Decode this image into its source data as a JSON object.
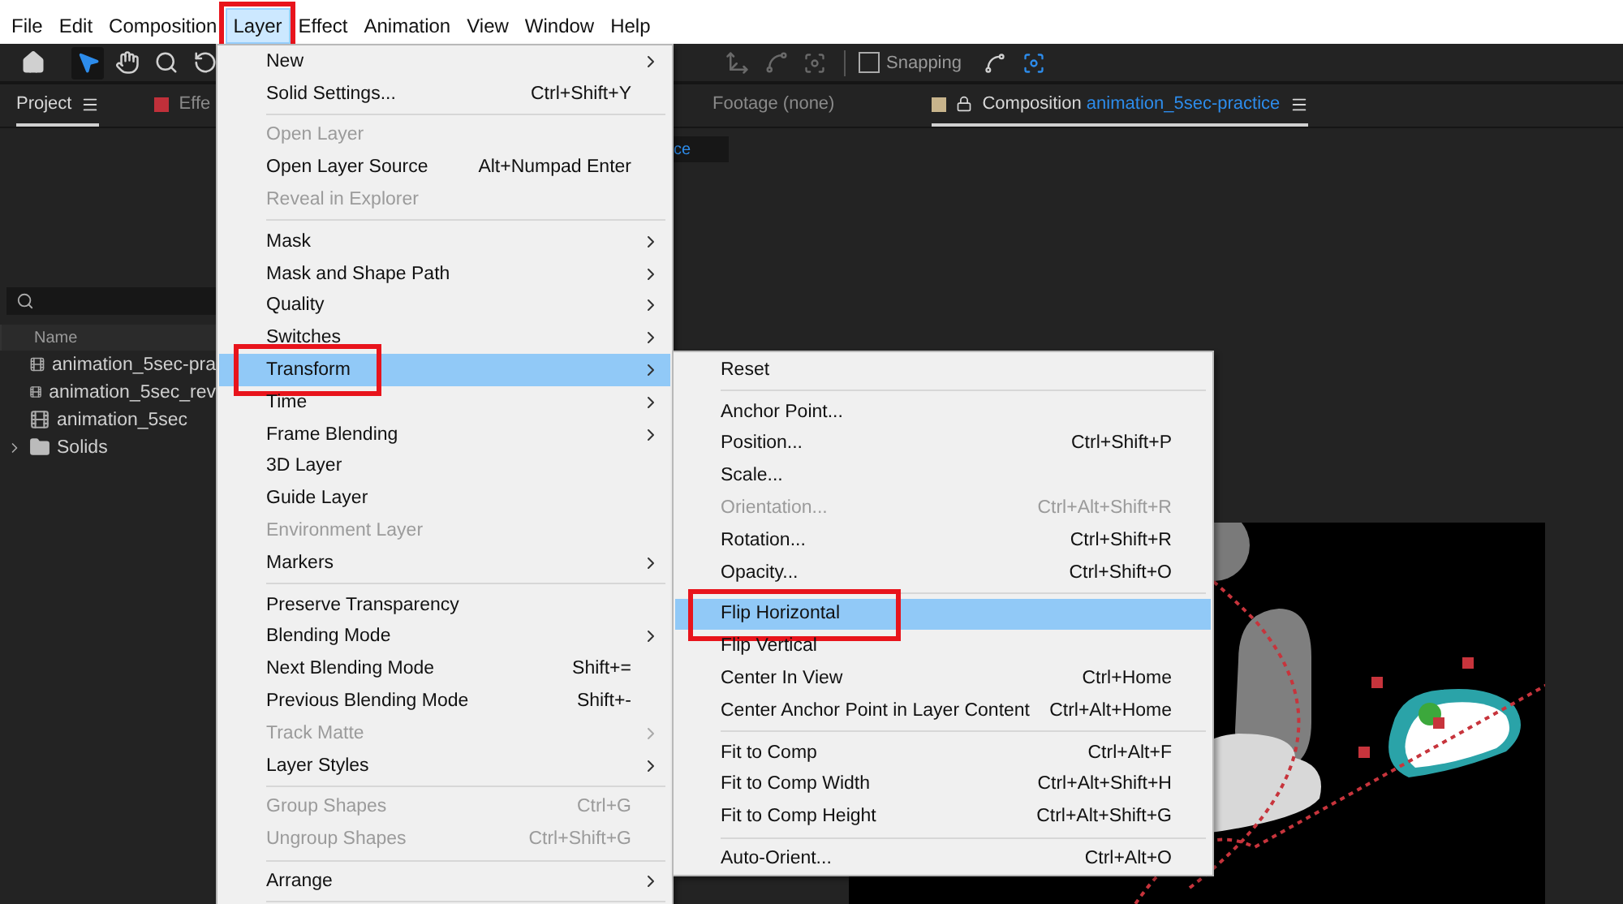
{
  "menu_bar": [
    {
      "label": "File",
      "selected": false,
      "outlined": false
    },
    {
      "label": "Edit",
      "selected": false,
      "outlined": false
    },
    {
      "label": "Composition",
      "selected": false,
      "outlined": false
    },
    {
      "label": "Layer",
      "selected": true,
      "outlined": true
    },
    {
      "label": "Effect",
      "selected": false,
      "outlined": false
    },
    {
      "label": "Animation",
      "selected": false,
      "outlined": false
    },
    {
      "label": "View",
      "selected": false,
      "outlined": false
    },
    {
      "label": "Window",
      "selected": false,
      "outlined": false
    },
    {
      "label": "Help",
      "selected": false,
      "outlined": false
    }
  ],
  "toolbar": {
    "snapping": {
      "label": "Snapping",
      "checked": false
    }
  },
  "project_panel": {
    "tabs": [
      {
        "label": "Project",
        "selected": true
      },
      {
        "label": "Effe",
        "selected": false
      }
    ],
    "column": "Name",
    "items": [
      {
        "kind": "composition",
        "label": "animation_5sec-pra"
      },
      {
        "kind": "composition",
        "label": "animation_5sec_rev"
      },
      {
        "kind": "composition",
        "label": "animation_5sec"
      },
      {
        "kind": "folder",
        "label": "Solids"
      }
    ]
  },
  "viewer": {
    "tabs": [
      {
        "label": "Footage (none)",
        "selected": false
      },
      {
        "label": "Composition",
        "name": "animation_5sec-practice",
        "selected": true
      }
    ],
    "field_value": "ce"
  },
  "layer_menu": {
    "items": [
      {
        "kind": "item",
        "label": "New",
        "submenu": true,
        "disabled": false,
        "selected": false,
        "outlined": false
      },
      {
        "kind": "item",
        "label": "Solid Settings...",
        "shortcut": "Ctrl+Shift+Y",
        "submenu": false,
        "disabled": false,
        "selected": false,
        "outlined": false
      },
      {
        "kind": "separator"
      },
      {
        "kind": "item",
        "label": "Open Layer",
        "submenu": false,
        "disabled": true,
        "selected": false,
        "outlined": false
      },
      {
        "kind": "item",
        "label": "Open Layer Source",
        "shortcut": "Alt+Numpad Enter",
        "submenu": false,
        "disabled": false,
        "selected": false,
        "outlined": false
      },
      {
        "kind": "item",
        "label": "Reveal in Explorer",
        "submenu": false,
        "disabled": true,
        "selected": false,
        "outlined": false
      },
      {
        "kind": "separator"
      },
      {
        "kind": "item",
        "label": "Mask",
        "submenu": true,
        "disabled": false,
        "selected": false,
        "outlined": false
      },
      {
        "kind": "item",
        "label": "Mask and Shape Path",
        "submenu": true,
        "disabled": false,
        "selected": false,
        "outlined": false
      },
      {
        "kind": "item",
        "label": "Quality",
        "submenu": true,
        "disabled": false,
        "selected": false,
        "outlined": false
      },
      {
        "kind": "item",
        "label": "Switches",
        "submenu": true,
        "disabled": false,
        "selected": false,
        "outlined": false
      },
      {
        "kind": "item",
        "label": "Transform",
        "submenu": true,
        "disabled": false,
        "selected": true,
        "outlined": true
      },
      {
        "kind": "item",
        "label": "Time",
        "submenu": true,
        "disabled": false,
        "selected": false,
        "outlined": false
      },
      {
        "kind": "item",
        "label": "Frame Blending",
        "submenu": true,
        "disabled": false,
        "selected": false,
        "outlined": false
      },
      {
        "kind": "item",
        "label": "3D Layer",
        "submenu": false,
        "disabled": false,
        "selected": false,
        "outlined": false
      },
      {
        "kind": "item",
        "label": "Guide Layer",
        "submenu": false,
        "disabled": false,
        "selected": false,
        "outlined": false
      },
      {
        "kind": "item",
        "label": "Environment Layer",
        "submenu": false,
        "disabled": true,
        "selected": false,
        "outlined": false
      },
      {
        "kind": "item",
        "label": "Markers",
        "submenu": true,
        "disabled": false,
        "selected": false,
        "outlined": false
      },
      {
        "kind": "separator"
      },
      {
        "kind": "item",
        "label": "Preserve Transparency",
        "submenu": false,
        "disabled": false,
        "selected": false,
        "outlined": false
      },
      {
        "kind": "item",
        "label": "Blending Mode",
        "submenu": true,
        "disabled": false,
        "selected": false,
        "outlined": false
      },
      {
        "kind": "item",
        "label": "Next Blending Mode",
        "shortcut": "Shift+=",
        "submenu": false,
        "disabled": false,
        "selected": false,
        "outlined": false
      },
      {
        "kind": "item",
        "label": "Previous Blending Mode",
        "shortcut": "Shift+-",
        "submenu": false,
        "disabled": false,
        "selected": false,
        "outlined": false
      },
      {
        "kind": "item",
        "label": "Track Matte",
        "submenu": true,
        "disabled": true,
        "selected": false,
        "outlined": false
      },
      {
        "kind": "item",
        "label": "Layer Styles",
        "submenu": true,
        "disabled": false,
        "selected": false,
        "outlined": false
      },
      {
        "kind": "separator"
      },
      {
        "kind": "item",
        "label": "Group Shapes",
        "shortcut": "Ctrl+G",
        "submenu": false,
        "disabled": true,
        "selected": false,
        "outlined": false
      },
      {
        "kind": "item",
        "label": "Ungroup Shapes",
        "shortcut": "Ctrl+Shift+G",
        "submenu": false,
        "disabled": true,
        "selected": false,
        "outlined": false
      },
      {
        "kind": "separator"
      },
      {
        "kind": "item",
        "label": "Arrange",
        "submenu": true,
        "disabled": false,
        "selected": false,
        "outlined": false
      },
      {
        "kind": "separator"
      }
    ]
  },
  "transform_submenu": {
    "items": [
      {
        "kind": "item",
        "label": "Reset",
        "submenu": false,
        "disabled": false,
        "selected": false,
        "outlined": false
      },
      {
        "kind": "separator"
      },
      {
        "kind": "item",
        "label": "Anchor Point...",
        "submenu": false,
        "disabled": false,
        "selected": false,
        "outlined": false
      },
      {
        "kind": "item",
        "label": "Position...",
        "shortcut": "Ctrl+Shift+P",
        "submenu": false,
        "disabled": false,
        "selected": false,
        "outlined": false
      },
      {
        "kind": "item",
        "label": "Scale...",
        "submenu": false,
        "disabled": false,
        "selected": false,
        "outlined": false
      },
      {
        "kind": "item",
        "label": "Orientation...",
        "shortcut": "Ctrl+Alt+Shift+R",
        "submenu": false,
        "disabled": true,
        "selected": false,
        "outlined": false
      },
      {
        "kind": "item",
        "label": "Rotation...",
        "shortcut": "Ctrl+Shift+R",
        "submenu": false,
        "disabled": false,
        "selected": false,
        "outlined": false
      },
      {
        "kind": "item",
        "label": "Opacity...",
        "shortcut": "Ctrl+Shift+O",
        "submenu": false,
        "disabled": false,
        "selected": false,
        "outlined": false
      },
      {
        "kind": "separator"
      },
      {
        "kind": "item",
        "label": "Flip Horizontal",
        "submenu": false,
        "disabled": false,
        "selected": true,
        "outlined": true
      },
      {
        "kind": "item",
        "label": "Flip Vertical",
        "submenu": false,
        "disabled": false,
        "selected": false,
        "outlined": false
      },
      {
        "kind": "item",
        "label": "Center In View",
        "shortcut": "Ctrl+Home",
        "submenu": false,
        "disabled": false,
        "selected": false,
        "outlined": false
      },
      {
        "kind": "item",
        "label": "Center Anchor Point in Layer Content",
        "shortcut": "Ctrl+Alt+Home",
        "submenu": false,
        "disabled": false,
        "selected": false,
        "outlined": false
      },
      {
        "kind": "separator"
      },
      {
        "kind": "item",
        "label": "Fit to Comp",
        "shortcut": "Ctrl+Alt+F",
        "submenu": false,
        "disabled": false,
        "selected": false,
        "outlined": false
      },
      {
        "kind": "item",
        "label": "Fit to Comp Width",
        "shortcut": "Ctrl+Alt+Shift+H",
        "submenu": false,
        "disabled": false,
        "selected": false,
        "outlined": false
      },
      {
        "kind": "item",
        "label": "Fit to Comp Height",
        "shortcut": "Ctrl+Alt+Shift+G",
        "submenu": false,
        "disabled": false,
        "selected": false,
        "outlined": false
      },
      {
        "kind": "separator"
      },
      {
        "kind": "item",
        "label": "Auto-Orient...",
        "shortcut": "Ctrl+Alt+O",
        "submenu": false,
        "disabled": false,
        "selected": false,
        "outlined": false
      }
    ]
  }
}
